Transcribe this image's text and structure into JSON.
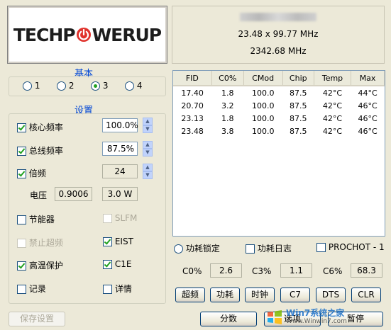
{
  "logo": {
    "text_left": "TECHP",
    "text_right": "WERUP"
  },
  "info": {
    "multiplier_line": "23.48 x 99.77 MHz",
    "freq_line": "2342.68 MHz"
  },
  "basic": {
    "title": "基本",
    "radios": [
      {
        "label": "1",
        "checked": false
      },
      {
        "label": "2",
        "checked": false
      },
      {
        "label": "3",
        "checked": true
      },
      {
        "label": "4",
        "checked": false
      }
    ]
  },
  "settings": {
    "title": "设置",
    "core_freq": {
      "label": "核心频率",
      "value": "100.0%"
    },
    "bus_freq": {
      "label": "总线频率",
      "value": "87.5%"
    },
    "multiplier": {
      "label": "倍频",
      "value": "24"
    },
    "voltage": {
      "label": "电压",
      "value": "0.9006",
      "power": "3.0 W"
    },
    "energy_saver": "节能器",
    "slfm": "SLFM",
    "disable_turbo": "禁止超频",
    "eist": "EIST",
    "thermal": "高温保护",
    "c1e": "C1E",
    "log": "记录",
    "details": "详情"
  },
  "table": {
    "headers": [
      "FID",
      "C0%",
      "CMod",
      "Chip",
      "Temp",
      "Max"
    ],
    "rows": [
      [
        "17.40",
        "1.8",
        "100.0",
        "87.5",
        "42°C",
        "44°C"
      ],
      [
        "20.70",
        "3.2",
        "100.0",
        "87.5",
        "42°C",
        "46°C"
      ],
      [
        "23.13",
        "1.8",
        "100.0",
        "87.5",
        "42°C",
        "46°C"
      ],
      [
        "23.48",
        "3.8",
        "100.0",
        "87.5",
        "42°C",
        "46°C"
      ]
    ]
  },
  "options": {
    "power_lock": "功耗锁定",
    "power_log": "功耗日志",
    "prochot": "PROCHOT - 1"
  },
  "cstates": {
    "c0_label": "C0%",
    "c0_value": "2.6",
    "c3_label": "C3%",
    "c3_value": "1.1",
    "c6_label": "C6%",
    "c6_value": "68.3"
  },
  "buttons": {
    "turbo": "超频",
    "power": "功耗",
    "clock": "时钟",
    "c7": "C7",
    "dts": "DTS",
    "clr": "CLR",
    "save": "保存设置",
    "split": "分数",
    "options": "选项",
    "hide": "暂停"
  },
  "watermark": {
    "brand": "Win7系统之家",
    "url": "Www.Winwin7.com"
  },
  "colors": {
    "accent": "#0046d5",
    "logo_red": "#e0312b",
    "check_green": "#21a121"
  }
}
